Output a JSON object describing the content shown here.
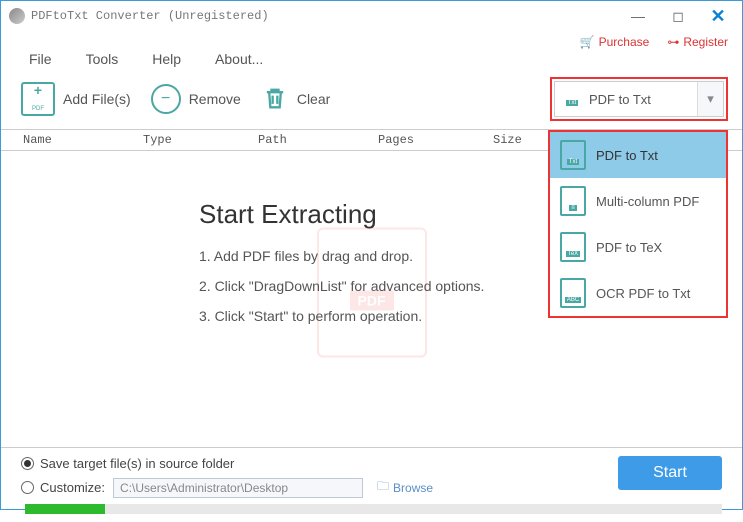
{
  "title": "PDFtoTxt Converter (Unregistered)",
  "links": {
    "purchase": "Purchase",
    "register": "Register"
  },
  "menu": {
    "file": "File",
    "tools": "Tools",
    "help": "Help",
    "about": "About..."
  },
  "toolbar": {
    "addfiles": "Add File(s)",
    "remove": "Remove",
    "clear": "Clear"
  },
  "convert": {
    "selected": "PDF to Txt",
    "options": [
      {
        "label": "PDF to Txt",
        "tag": "Txt"
      },
      {
        "label": "Multi-column PDF",
        "tag": "≡"
      },
      {
        "label": "PDF to TeX",
        "tag": "TeX"
      },
      {
        "label": "OCR PDF to Txt",
        "tag": "ABC"
      }
    ]
  },
  "columns": {
    "name": "Name",
    "type": "Type",
    "path": "Path",
    "pages": "Pages",
    "size": "Size"
  },
  "instructions": {
    "heading": "Start Extracting",
    "step1": "1. Add PDF files by drag and drop.",
    "step2": "2. Click \"DragDownList\" for advanced options.",
    "step3": "3. Click \"Start\" to perform operation."
  },
  "output": {
    "source_label": "Save target file(s) in source folder",
    "customize_label": "Customize:",
    "path": "C:\\Users\\Administrator\\Desktop",
    "browse": "Browse"
  },
  "start": "Start"
}
